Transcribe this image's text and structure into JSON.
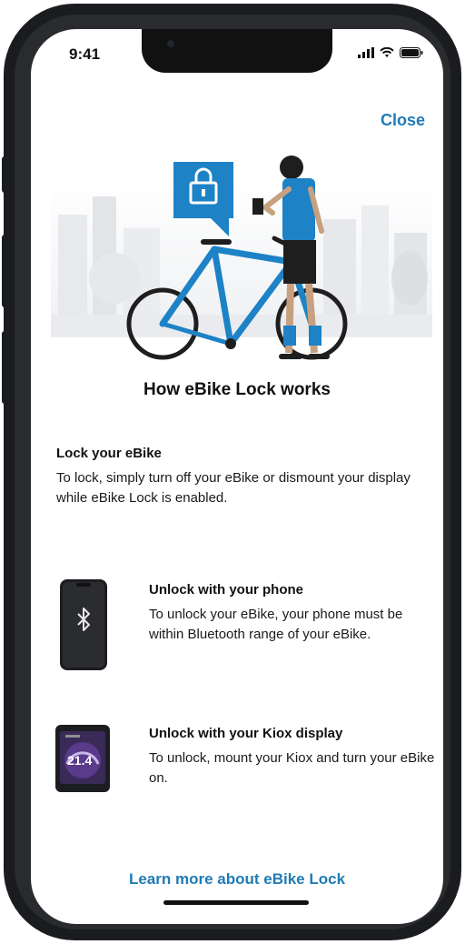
{
  "status_bar": {
    "time": "9:41"
  },
  "header": {
    "close_label": "Close"
  },
  "hero": {
    "title": "How eBike Lock works"
  },
  "lock_section": {
    "title": "Lock your eBike",
    "text": "To lock, simply turn off your eBike or dismount your display while eBike Lock is enabled."
  },
  "unlock_items": [
    {
      "icon": "phone-bluetooth-icon",
      "title": "Unlock with your phone",
      "text": "To unlock your eBike, your phone must be within Bluetooth range of your eBike."
    },
    {
      "icon": "kiox-display-icon",
      "title": "Unlock with your Kiox display",
      "text": "To unlock, mount your Kiox and turn your eBike on.",
      "display_value": "21.4"
    }
  ],
  "footer": {
    "learn_more_label": "Learn more about eBike Lock"
  },
  "colors": {
    "accent": "#1f7bb6",
    "bike_blue": "#1d82c6"
  }
}
